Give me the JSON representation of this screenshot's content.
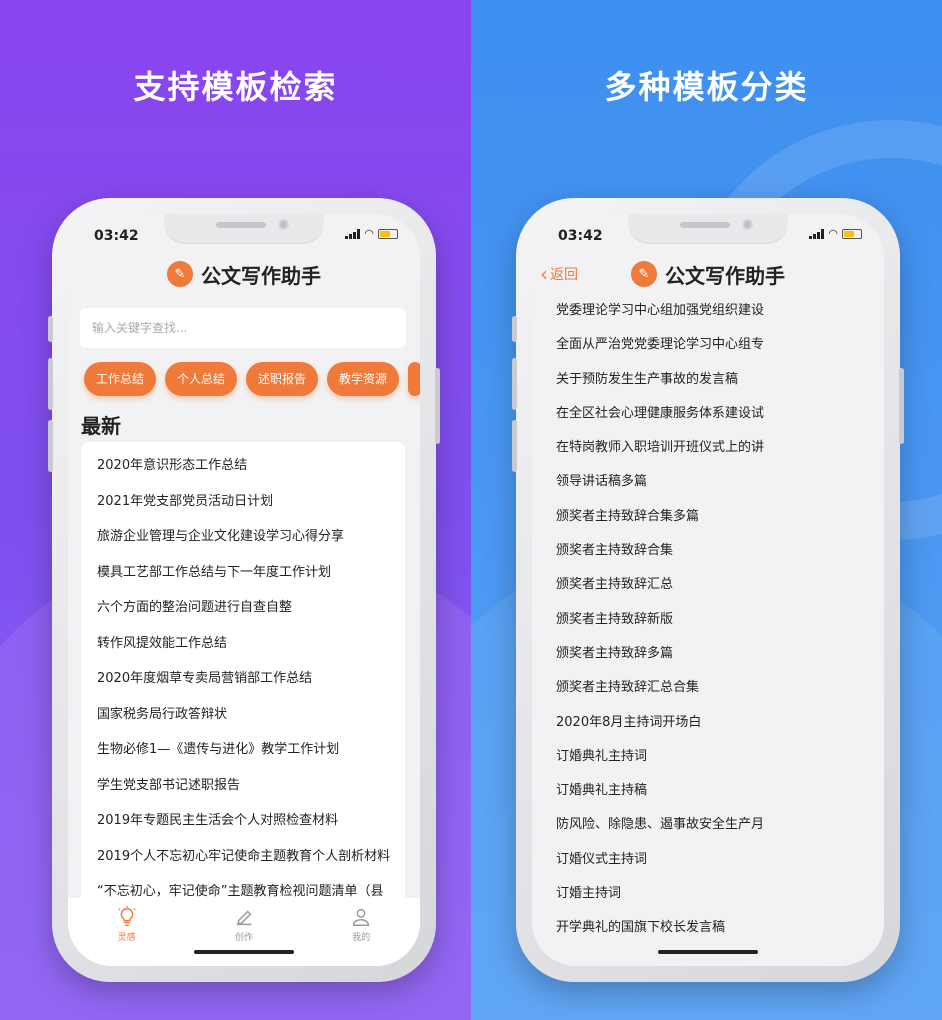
{
  "left": {
    "headline": "支持模板检索",
    "status_time": "03:42",
    "app_title": "公文写作助手",
    "search_placeholder": "输入关键字查找...",
    "chips": [
      "工作总结",
      "个人总结",
      "述职报告",
      "教学资源"
    ],
    "section_title": "最新",
    "items": [
      "2020年意识形态工作总结",
      "2021年党支部党员活动日计划",
      "旅游企业管理与企业文化建设学习心得分享",
      "模具工艺部工作总结与下一年度工作计划",
      "六个方面的整治问题进行自查自整",
      "转作风提效能工作总结",
      "2020年度烟草专卖局营销部工作总结",
      "国家税务局行政答辩状",
      "生物必修1—《遗传与进化》教学工作计划",
      "学生党支部书记述职报告",
      "2019年专题民主生活会个人对照检查材料",
      "2019个人不忘初心牢记使命主题教育个人剖析材料",
      "“不忘初心，牢记使命”主题教育检视问题清单（县"
    ],
    "tabs": [
      {
        "label": "灵感",
        "icon": "bulb-icon"
      },
      {
        "label": "创作",
        "icon": "pen-icon"
      },
      {
        "label": "我的",
        "icon": "user-icon"
      }
    ]
  },
  "right": {
    "headline": "多种模板分类",
    "status_time": "03:42",
    "app_title": "公文写作助手",
    "back_label": "返回",
    "items": [
      "党委理论学习中心组加强党组织建设",
      "全面从严治党党委理论学习中心组专",
      "关于预防发生生产事故的发言稿",
      "在全区社会心理健康服务体系建设试",
      "在特岗教师入职培训开班仪式上的讲",
      "领导讲话稿多篇",
      "颁奖者主持致辞合集多篇",
      "颁奖者主持致辞合集",
      "颁奖者主持致辞汇总",
      "颁奖者主持致辞新版",
      "颁奖者主持致辞多篇",
      "颁奖者主持致辞汇总合集",
      "2020年8月主持词开场白",
      "订婚典礼主持词",
      "订婚典礼主持稿",
      "防风险、除隐患、遏事故安全生产月",
      "订婚仪式主持词",
      "订婚主持词",
      "开学典礼的国旗下校长发言稿"
    ]
  },
  "colors": {
    "accent": "#f07a3a",
    "left_bg": "#8a45ee",
    "right_bg": "#3d8ff0"
  }
}
